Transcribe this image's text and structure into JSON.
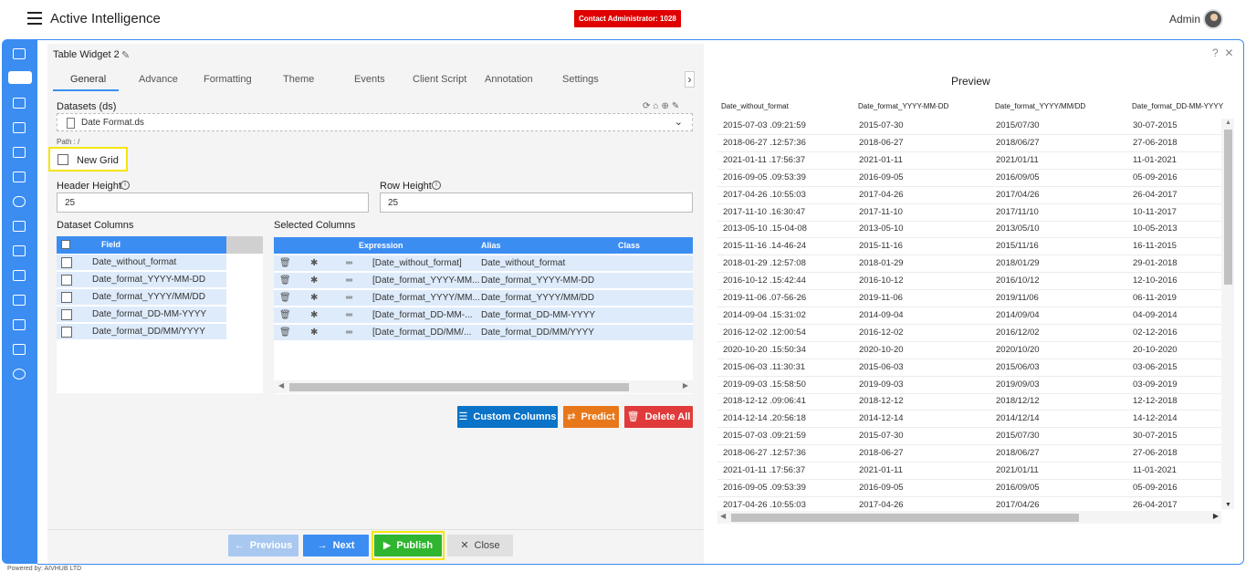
{
  "header": {
    "app_title": "Active Intelligence",
    "contact_badge": "Contact Administrator: 1028",
    "user_label": "Admin"
  },
  "sidebar": {
    "icons": [
      "login-icon",
      "table-widget-icon",
      "chart-icon",
      "layers-icon",
      "document-icon",
      "id-card-icon",
      "braces-icon",
      "image-icon",
      "calendar-icon",
      "report-icon",
      "file-icon",
      "hierarchy-icon",
      "analytics-icon",
      "settings-icon"
    ]
  },
  "widget": {
    "title": "Table Widget 2",
    "tabs": [
      "General",
      "Advance",
      "Formatting",
      "Theme",
      "Events",
      "Client Script",
      "Annotation",
      "Settings"
    ],
    "active_tab": "General",
    "datasets_label": "Datasets (ds)",
    "dataset_value": "Date Format.ds",
    "path_label": "Path : /",
    "new_grid_label": "New Grid",
    "header_height_label": "Header Height",
    "header_height_value": "25",
    "row_height_label": "Row Height",
    "row_height_value": "25",
    "dataset_columns_label": "Dataset Columns",
    "selected_columns_label": "Selected Columns",
    "dataset_columns_header": "Field",
    "dataset_columns": [
      "Date_without_format",
      "Date_format_YYYY-MM-DD",
      "Date_format_YYYY/MM/DD",
      "Date_format_DD-MM-YYYY",
      "Date_format_DD/MM/YYYY"
    ],
    "selected_headers": {
      "expression": "Expression",
      "alias": "Alias",
      "class": "Class"
    },
    "selected_columns": [
      {
        "expression": "[Date_without_format]",
        "alias": "Date_without_format"
      },
      {
        "expression": "[Date_format_YYYY-MM...",
        "alias": "Date_format_YYYY-MM-DD"
      },
      {
        "expression": "[Date_format_YYYY/MM...",
        "alias": "Date_format_YYYY/MM/DD"
      },
      {
        "expression": "[Date_format_DD-MM-...",
        "alias": "Date_format_DD-MM-YYYY"
      },
      {
        "expression": "[Date_format_DD/MM/...",
        "alias": "Date_format_DD/MM/YYYY"
      }
    ],
    "buttons": {
      "custom_columns": "Custom Columns",
      "predict": "Predict",
      "delete_all": "Delete All",
      "previous": "Previous",
      "next": "Next",
      "publish": "Publish",
      "close": "Close"
    },
    "colors": {
      "accent": "#3b8df2",
      "predict": "#e8771a",
      "delete": "#e03a3a",
      "publish": "#2fb52f",
      "highlight": "#f5e50a"
    }
  },
  "preview": {
    "title": "Preview",
    "help": "?",
    "close": "✕",
    "columns": [
      "Date_without_format",
      "Date_format_YYYY-MM-DD",
      "Date_format_YYYY/MM/DD",
      "Date_format_DD-MM-YYYY"
    ],
    "rows": [
      [
        "2015-07-03 .09:21:59",
        "2015-07-30",
        "2015/07/30",
        "30-07-2015"
      ],
      [
        "2018-06-27 .12:57:36",
        "2018-06-27",
        "2018/06/27",
        "27-06-2018"
      ],
      [
        "2021-01-11 .17:56:37",
        "2021-01-11",
        "2021/01/11",
        "11-01-2021"
      ],
      [
        "2016-09-05 .09:53:39",
        "2016-09-05",
        "2016/09/05",
        "05-09-2016"
      ],
      [
        "2017-04-26 .10:55:03",
        "2017-04-26",
        "2017/04/26",
        "26-04-2017"
      ],
      [
        "2017-11-10 .16:30:47",
        "2017-11-10",
        "2017/11/10",
        "10-11-2017"
      ],
      [
        "2013-05-10 .15-04-08",
        "2013-05-10",
        "2013/05/10",
        "10-05-2013"
      ],
      [
        "2015-11-16 .14-46-24",
        "2015-11-16",
        "2015/11/16",
        "16-11-2015"
      ],
      [
        "2018-01-29 .12:57:08",
        "2018-01-29",
        "2018/01/29",
        "29-01-2018"
      ],
      [
        "2016-10-12 .15:42:44",
        "2016-10-12",
        "2016/10/12",
        "12-10-2016"
      ],
      [
        "2019-11-06 .07-56-26",
        "2019-11-06",
        "2019/11/06",
        "06-11-2019"
      ],
      [
        "2014-09-04 .15:31:02",
        "2014-09-04",
        "2014/09/04",
        "04-09-2014"
      ],
      [
        "2016-12-02 .12:00:54",
        "2016-12-02",
        "2016/12/02",
        "02-12-2016"
      ],
      [
        "2020-10-20 .15:50:34",
        "2020-10-20",
        "2020/10/20",
        "20-10-2020"
      ],
      [
        "2015-06-03 .11:30:31",
        "2015-06-03",
        "2015/06/03",
        "03-06-2015"
      ],
      [
        "2019-09-03 .15:58:50",
        "2019-09-03",
        "2019/09/03",
        "03-09-2019"
      ],
      [
        "2018-12-12 .09:06:41",
        "2018-12-12",
        "2018/12/12",
        "12-12-2018"
      ],
      [
        "2014-12-14 .20:56:18",
        "2014-12-14",
        "2014/12/14",
        "14-12-2014"
      ],
      [
        "2015-07-03 .09:21:59",
        "2015-07-30",
        "2015/07/30",
        "30-07-2015"
      ],
      [
        "2018-06-27 .12:57:36",
        "2018-06-27",
        "2018/06/27",
        "27-06-2018"
      ],
      [
        "2021-01-11 .17:56:37",
        "2021-01-11",
        "2021/01/11",
        "11-01-2021"
      ],
      [
        "2016-09-05 .09:53:39",
        "2016-09-05",
        "2016/09/05",
        "05-09-2016"
      ],
      [
        "2017-04-26 .10:55:03",
        "2017-04-26",
        "2017/04/26",
        "26-04-2017"
      ]
    ]
  },
  "footer": {
    "powered_by": "Powered by: AIVHUB LTD"
  }
}
